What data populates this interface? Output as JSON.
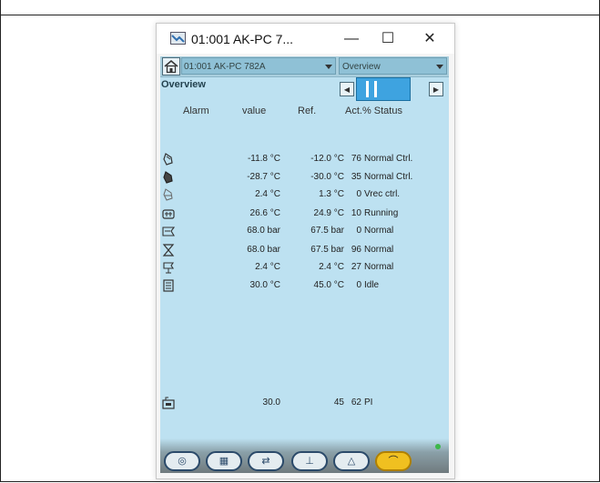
{
  "window": {
    "title": "01:001 AK-PC 7...",
    "minimize": "—",
    "maximize": "☐",
    "close": "✕"
  },
  "toolbar": {
    "device": "01:001 AK-PC 782A",
    "view": "Overview",
    "section_label": "Overview"
  },
  "nav": {
    "prev": "◀",
    "next": "▶"
  },
  "columns": {
    "alarm": "Alarm",
    "value": "value",
    "ref": "Ref.",
    "act_status": "Act.% Status"
  },
  "rows": [
    {
      "icon": "suction-icon",
      "value": "-11.8 °C",
      "ref": "-12.0 °C",
      "act": "76",
      "status": "Normal Ctrl."
    },
    {
      "icon": "suction-filled-icon",
      "value": "-28.7 °C",
      "ref": "-30.0 °C",
      "act": "35",
      "status": "Normal Ctrl."
    },
    {
      "icon": "receiver-icon",
      "value": "2.4 °C",
      "ref": "1.3 °C",
      "act": "0",
      "status": "Vrec ctrl."
    },
    {
      "icon": "gascooler-icon",
      "value": "26.6 °C",
      "ref": "24.9 °C",
      "act": "10",
      "status": "Running"
    },
    {
      "icon": "valve-icon",
      "value": "68.0 bar",
      "ref": "67.5 bar",
      "act": "0",
      "status": "Normal"
    },
    {
      "icon": "hp-valve-icon",
      "value": "68.0 bar",
      "ref": "67.5 bar",
      "act": "96",
      "status": "Normal"
    },
    {
      "icon": "heat-recovery-icon",
      "value": "2.4 °C",
      "ref": "2.4 °C",
      "act": "27",
      "status": "Normal"
    },
    {
      "icon": "heater-icon",
      "value": "30.0 °C",
      "ref": "45.0 °C",
      "act": "0",
      "status": "Idle"
    }
  ],
  "pi_row": {
    "icon": "pi-icon",
    "value": "30.0",
    "ref": "45",
    "act": "62",
    "status": "PI"
  },
  "bottom_tabs": [
    "overview-tab",
    "list-tab",
    "compressor-tab",
    "graph-tab",
    "alarm-tab",
    "service-tab"
  ],
  "colors": {
    "background": "#bde1f1",
    "toolbar": "#a9cedd",
    "accent": "#3ea3e0",
    "active_tab": "#f0c020",
    "status_dot": "#3cb84a"
  }
}
